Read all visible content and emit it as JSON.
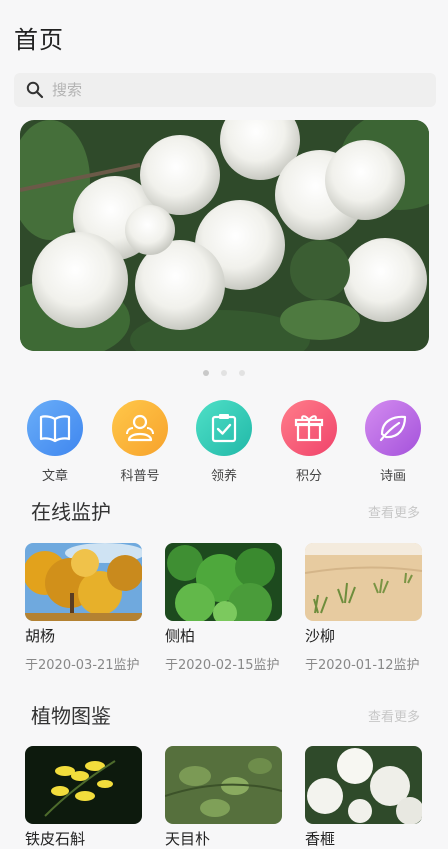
{
  "page": {
    "title": "首页"
  },
  "search": {
    "placeholder": "搜索"
  },
  "banner": {
    "pages": 3,
    "active_index": 0
  },
  "categories": [
    {
      "label": "文章",
      "icon": "book-icon",
      "color_from": "#6aaef8",
      "color_to": "#3f86ef"
    },
    {
      "label": "科普号",
      "icon": "people-icon",
      "color_from": "#ffc84a",
      "color_to": "#f7a22c"
    },
    {
      "label": "领养",
      "icon": "clipboard-check-icon",
      "color_from": "#4fe0c7",
      "color_to": "#21b8a8"
    },
    {
      "label": "积分",
      "icon": "gift-icon",
      "color_from": "#ff7d8a",
      "color_to": "#f0436b"
    },
    {
      "label": "诗画",
      "icon": "leaf-icon",
      "color_from": "#d48cf0",
      "color_to": "#a452db"
    }
  ],
  "monitoring": {
    "title": "在线监护",
    "more_label": "查看更多",
    "items": [
      {
        "name": "胡杨",
        "date": "于2020-03-21监护",
        "thumb": "golden-tree"
      },
      {
        "name": "侧柏",
        "date": "于2020-02-15监护",
        "thumb": "green-conifer"
      },
      {
        "name": "沙柳",
        "date": "于2020-01-12监护",
        "thumb": "desert-shrubs"
      }
    ]
  },
  "atlas": {
    "title": "植物图鉴",
    "more_label": "查看更多",
    "items": [
      {
        "name": "铁皮石斛",
        "thumb": "yellow-orchid"
      },
      {
        "name": "天目朴",
        "thumb": "green-leaves"
      },
      {
        "name": "香榧",
        "thumb": "white-flowers"
      }
    ]
  }
}
